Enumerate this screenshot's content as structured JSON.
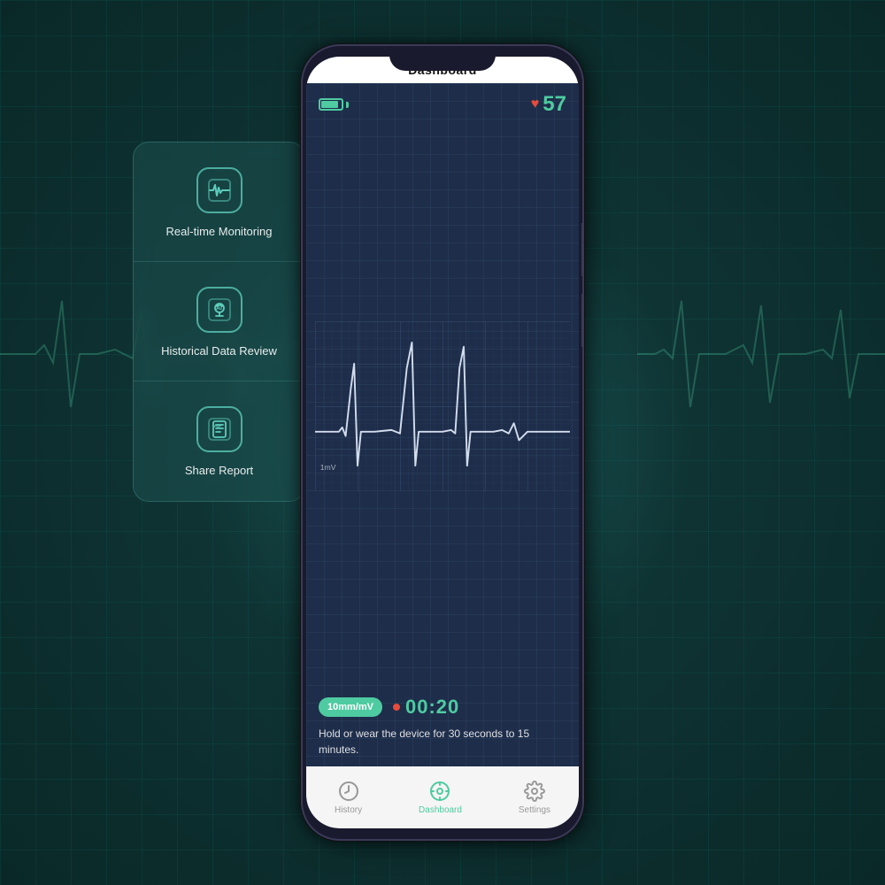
{
  "app": {
    "title": "Dashboard",
    "background_color": "#1a4a4a"
  },
  "feature_panel": {
    "items": [
      {
        "id": "realtime",
        "label": "Real-time\nMonitoring",
        "icon": "waveform"
      },
      {
        "id": "historical",
        "label": "Historical Data\nReview",
        "icon": "ai"
      },
      {
        "id": "share",
        "label": "Share Report",
        "icon": "pdf"
      }
    ]
  },
  "screen": {
    "title": "Dashboard",
    "heart_rate": "57",
    "scale_badge": "10mm/mV",
    "timer": "00:20",
    "ecg_label": "1mV",
    "instruction": "Hold or wear the device for 30 seconds to 15 minutes."
  },
  "nav": {
    "items": [
      {
        "label": "History",
        "active": false
      },
      {
        "label": "Dashboard",
        "active": true
      },
      {
        "label": "Settings",
        "active": false
      }
    ]
  }
}
